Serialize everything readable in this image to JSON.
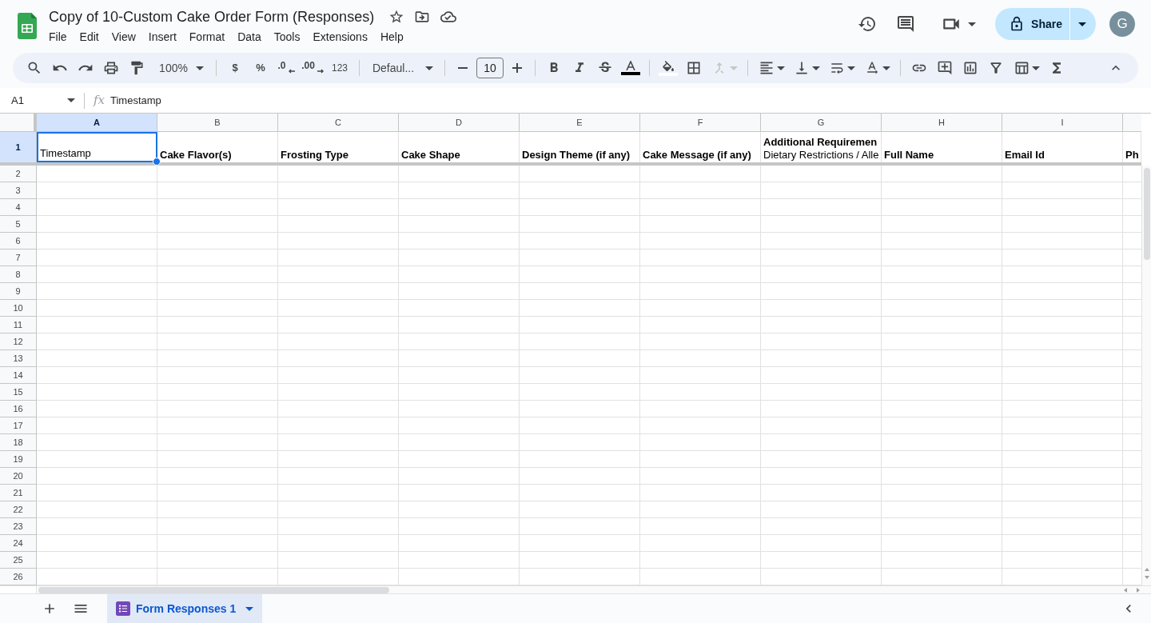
{
  "document": {
    "title": "Copy of 10-Custom Cake Order Form (Responses)"
  },
  "menu": [
    "File",
    "Edit",
    "View",
    "Insert",
    "Format",
    "Data",
    "Tools",
    "Extensions",
    "Help"
  ],
  "share": {
    "label": "Share"
  },
  "account": {
    "initial": "G"
  },
  "toolbar": {
    "zoom": "100%",
    "currency": "$",
    "percent": "%",
    "decrease_decimals": ".0",
    "increase_decimals": ".00",
    "number_format": "123",
    "font": "Defaul...",
    "font_size": "10",
    "merge_disabled": true
  },
  "formula_bar": {
    "cell_ref": "A1",
    "function_label": "fx",
    "value": "Timestamp"
  },
  "grid": {
    "columns": [
      {
        "label": "A",
        "selected": true
      },
      {
        "label": "B",
        "selected": false
      },
      {
        "label": "C",
        "selected": false
      },
      {
        "label": "D",
        "selected": false
      },
      {
        "label": "E",
        "selected": false
      },
      {
        "label": "F",
        "selected": false
      },
      {
        "label": "G",
        "selected": false
      },
      {
        "label": "H",
        "selected": false
      },
      {
        "label": "I",
        "selected": false
      }
    ],
    "rows": [
      {
        "label": "1",
        "selected": true,
        "cells": [
          {
            "selected": true,
            "lines": [
              {
                "text": "Timestamp",
                "bold": false
              }
            ]
          },
          {
            "selected": false,
            "lines": [
              {
                "text": "Cake Flavor(s)",
                "bold": true
              }
            ]
          },
          {
            "selected": false,
            "lines": [
              {
                "text": "Frosting Type",
                "bold": true
              }
            ]
          },
          {
            "selected": false,
            "lines": [
              {
                "text": "Cake Shape",
                "bold": true
              }
            ]
          },
          {
            "selected": false,
            "lines": [
              {
                "text": "Design Theme (if any)",
                "bold": true
              }
            ]
          },
          {
            "selected": false,
            "lines": [
              {
                "text": "Cake Message (if any)",
                "bold": true
              }
            ]
          },
          {
            "selected": false,
            "lines": [
              {
                "text": "Additional Requiremen",
                "bold": true
              },
              {
                "text": "Dietary Restrictions / Alle",
                "bold": false
              }
            ]
          },
          {
            "selected": false,
            "lines": [
              {
                "text": "Full Name",
                "bold": true
              }
            ]
          },
          {
            "selected": false,
            "lines": [
              {
                "text": "Email Id",
                "bold": true
              }
            ]
          },
          {
            "selected": false,
            "lines": [
              {
                "text": "Ph",
                "bold": true
              }
            ]
          }
        ]
      },
      {
        "label": "2",
        "selected": false
      },
      {
        "label": "3",
        "selected": false
      },
      {
        "label": "4",
        "selected": false
      },
      {
        "label": "5",
        "selected": false
      },
      {
        "label": "6",
        "selected": false
      },
      {
        "label": "7",
        "selected": false
      },
      {
        "label": "8",
        "selected": false
      },
      {
        "label": "9",
        "selected": false
      },
      {
        "label": "10",
        "selected": false
      },
      {
        "label": "11",
        "selected": false
      },
      {
        "label": "12",
        "selected": false
      },
      {
        "label": "13",
        "selected": false
      },
      {
        "label": "14",
        "selected": false
      },
      {
        "label": "15",
        "selected": false
      },
      {
        "label": "16",
        "selected": false
      },
      {
        "label": "17",
        "selected": false
      },
      {
        "label": "18",
        "selected": false
      },
      {
        "label": "19",
        "selected": false
      },
      {
        "label": "20",
        "selected": false
      },
      {
        "label": "21",
        "selected": false
      },
      {
        "label": "22",
        "selected": false
      },
      {
        "label": "23",
        "selected": false
      },
      {
        "label": "24",
        "selected": false
      },
      {
        "label": "25",
        "selected": false
      },
      {
        "label": "26",
        "selected": false
      }
    ]
  },
  "sheets": [
    {
      "label": "Form Responses 1",
      "selected": true
    }
  ]
}
